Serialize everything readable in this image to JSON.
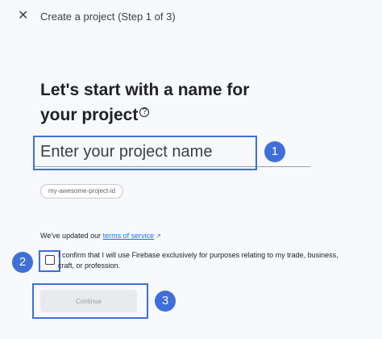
{
  "header": {
    "close_icon": "close-icon",
    "step_title": "Create a project (Step 1 of 3)"
  },
  "main": {
    "heading_line1": "Let's start with a name for",
    "heading_line2": "your project",
    "help_icon": "help-icon",
    "name_input": {
      "placeholder": "Enter your project name",
      "value": ""
    },
    "project_id": "my-awesome-project-id",
    "tos_prefix": "We've updated our ",
    "tos_link": "terms of service",
    "confirm_text": "I confirm that I will use Firebase exclusively for purposes relating to my trade, business, craft, or profession.",
    "continue_label": "Continue"
  },
  "annotations": [
    "1",
    "2",
    "3"
  ],
  "colors": {
    "accent": "#3f6fd8",
    "link": "#1a73e8",
    "disabled_button": "#e8eaed"
  }
}
